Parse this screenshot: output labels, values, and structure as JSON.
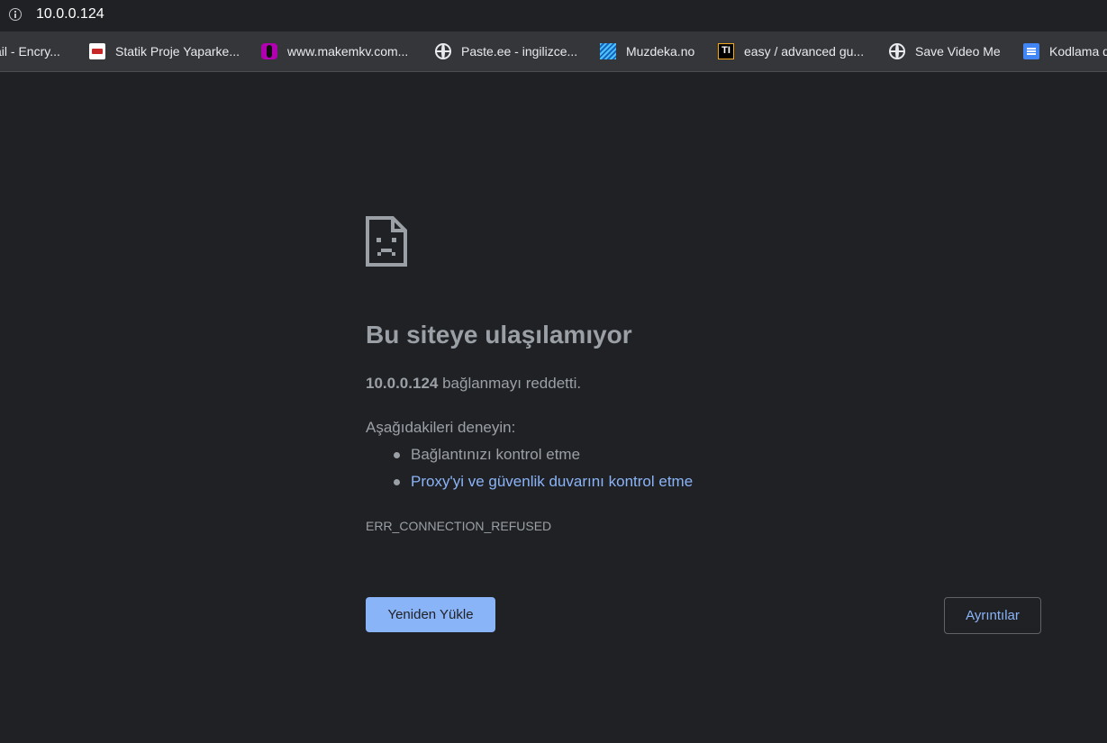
{
  "address_bar": {
    "url": "10.0.0.124",
    "icon": "info-icon"
  },
  "bookmarks": [
    {
      "label": "ail - Encry...",
      "icon": null
    },
    {
      "label": "Statik Proje Yaparke...",
      "icon": "red-logo-icon"
    },
    {
      "label": "www.makemkv.com...",
      "icon": "moth-icon"
    },
    {
      "label": "Paste.ee - ingilizce...",
      "icon": "globe-icon"
    },
    {
      "label": "Muzdeka.no",
      "icon": "stripes-icon"
    },
    {
      "label": "easy / advanced gu...",
      "icon": "ti-icon",
      "icon_text": "TI"
    },
    {
      "label": "Save Video Me",
      "icon": "globe-icon"
    },
    {
      "label": "Kodlama d",
      "icon": "docs-icon"
    }
  ],
  "error": {
    "icon": "sad-document-icon",
    "heading": "Bu siteye ulaşılamıyor",
    "summary_host": "10.0.0.124",
    "summary_text": " bağlanmayı reddetti.",
    "try_label": "Aşağıdakileri deneyin:",
    "suggestions": [
      {
        "text": "Bağlantınızı kontrol etme",
        "link": false
      },
      {
        "text": "Proxy'yi ve güvenlik duvarını kontrol etme",
        "link": true
      }
    ],
    "code": "ERR_CONNECTION_REFUSED",
    "reload_label": "Yeniden Yükle",
    "details_label": "Ayrıntılar"
  },
  "colors": {
    "background": "#202124",
    "bookmark_bar": "#35363a",
    "text": "#9aa0a6",
    "link": "#8ab4f8",
    "primary_button": "#8ab4f8"
  }
}
